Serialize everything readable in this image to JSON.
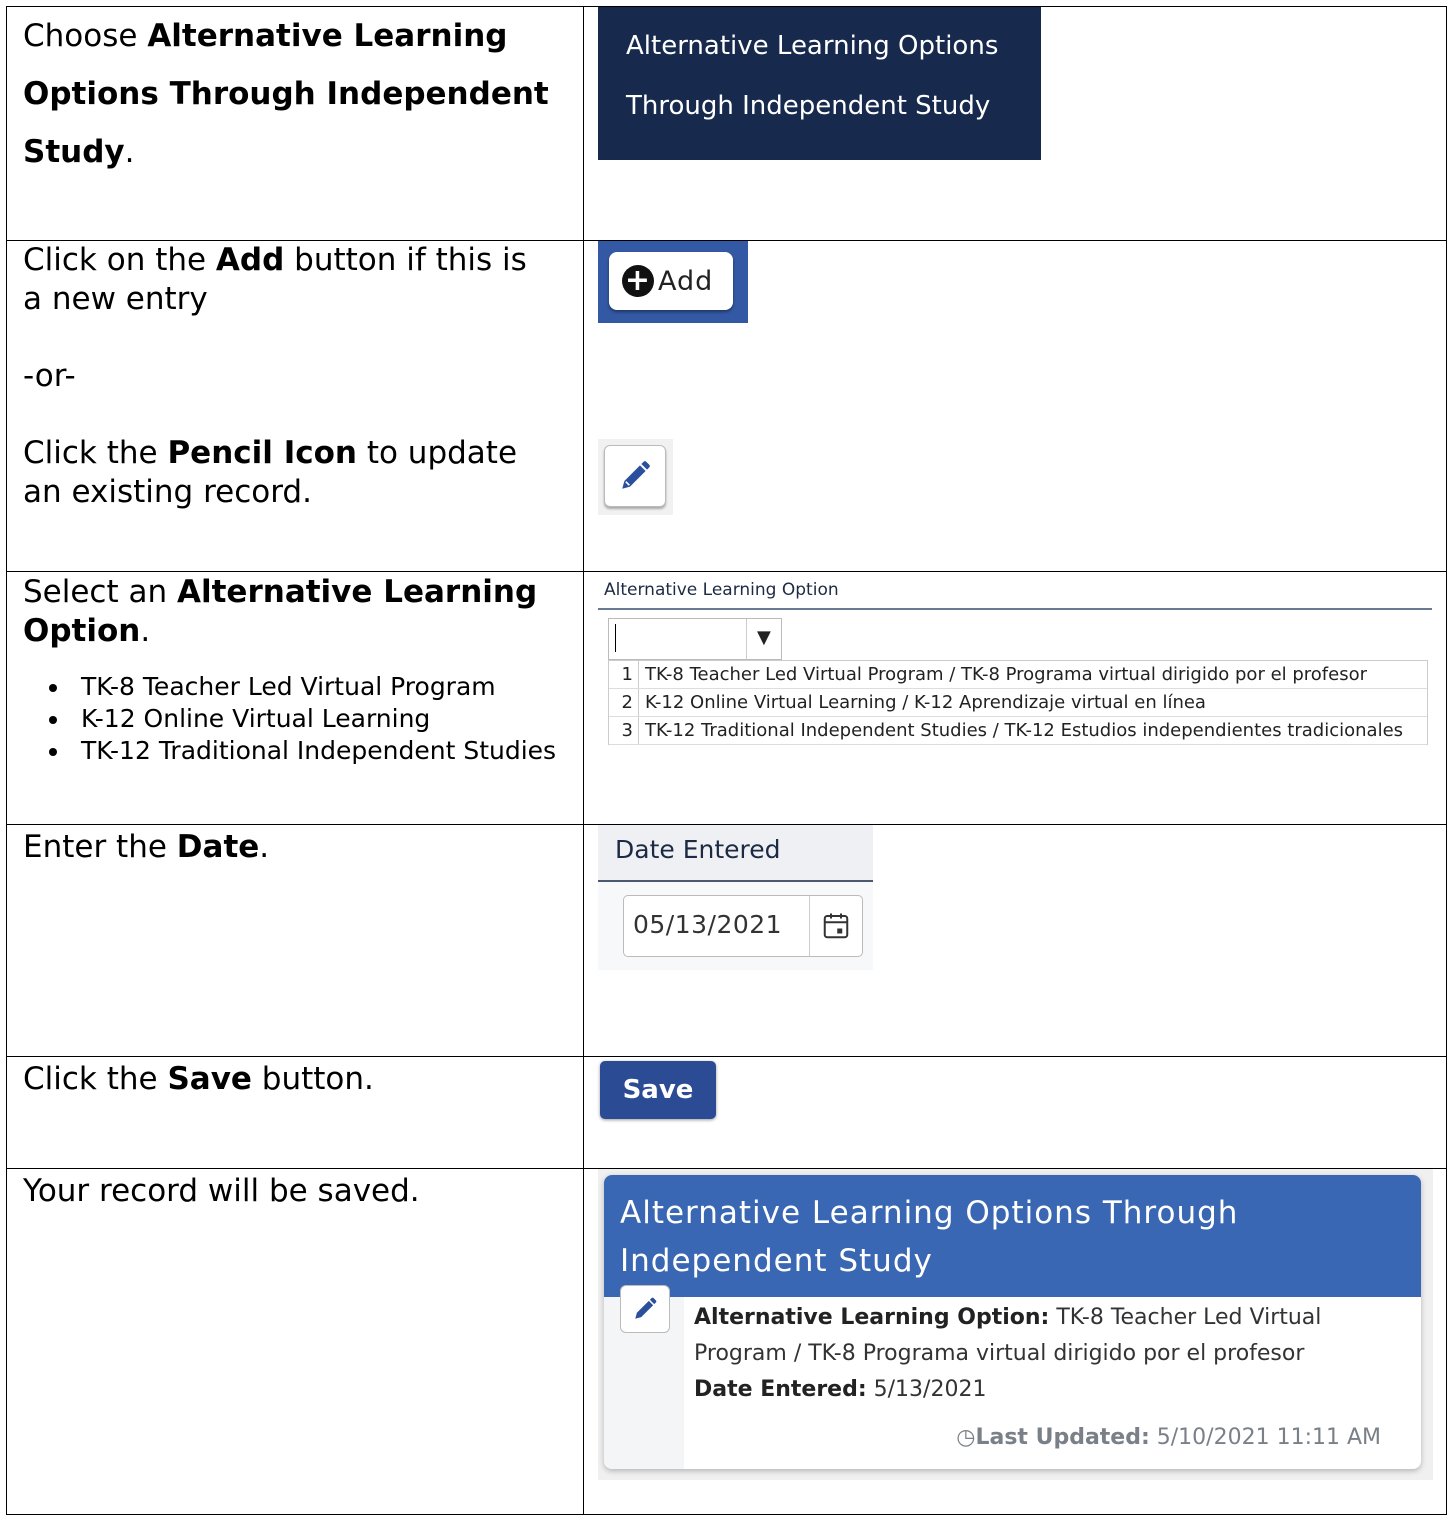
{
  "row1": {
    "left_prefix": "Choose ",
    "left_bold_1": "Alternative Learning",
    "left_bold_2": "Options Through Independent",
    "left_bold_3": "Study",
    "left_suffix": ".",
    "banner_line1": "Alternative Learning Options",
    "banner_line2": "Through Independent Study"
  },
  "row2": {
    "t1_prefix": "Click on the ",
    "t1_bold": "Add",
    "t1_suffix_a": " button if this is",
    "t1_suffix_b": "a new entry",
    "or": "-or-",
    "t2_prefix": "Click the ",
    "t2_bold": "Pencil Icon",
    "t2_suffix_a": " to update",
    "t2_suffix_b": "an existing record.",
    "add_label": "Add",
    "icons": {
      "add": "plus-circle-icon",
      "edit": "pencil-icon"
    }
  },
  "row3": {
    "left_prefix": "Select an ",
    "left_bold_1": "Alternative Learning",
    "left_bold_2": "Option",
    "left_suffix": ".",
    "bullets": [
      "TK-8 Teacher Led Virtual Program",
      "K-12 Online Virtual Learning",
      "TK-12 Traditional Independent Studies"
    ],
    "field_label": "Alternative Learning Option",
    "options": [
      {
        "num": "1",
        "text": "TK-8 Teacher Led Virtual Program / TK-8 Programa virtual dirigido por el profesor"
      },
      {
        "num": "2",
        "text": "K-12 Online Virtual Learning / K-12 Aprendizaje virtual en línea"
      },
      {
        "num": "3",
        "text": "TK-12 Traditional Independent Studies / TK-12 Estudios independientes tradicionales"
      }
    ]
  },
  "row4": {
    "left_prefix": "Enter the ",
    "left_bold": "Date",
    "left_suffix": ".",
    "field_label": "Date Entered",
    "date_value": "05/13/2021"
  },
  "row5": {
    "left_prefix": "Click the ",
    "left_bold": "Save",
    "left_suffix": " button.",
    "save_label": "Save"
  },
  "row6": {
    "left_text": "Your record will be saved.",
    "card_title": "Alternative Learning Options Through Independent Study",
    "alo_label": "Alternative Learning Option:",
    "alo_value": " TK-8 Teacher Led Virtual Program / TK-8 Programa virtual dirigido por el profesor",
    "date_label": "Date Entered:",
    "date_value": " 5/13/2021",
    "updated_label": "Last Updated:",
    "updated_value": " 5/10/2021 11:11 AM"
  },
  "colors": {
    "dark_navy": "#172a4e",
    "brand_blue": "#3a67b3",
    "save_blue": "#2b4b95"
  }
}
